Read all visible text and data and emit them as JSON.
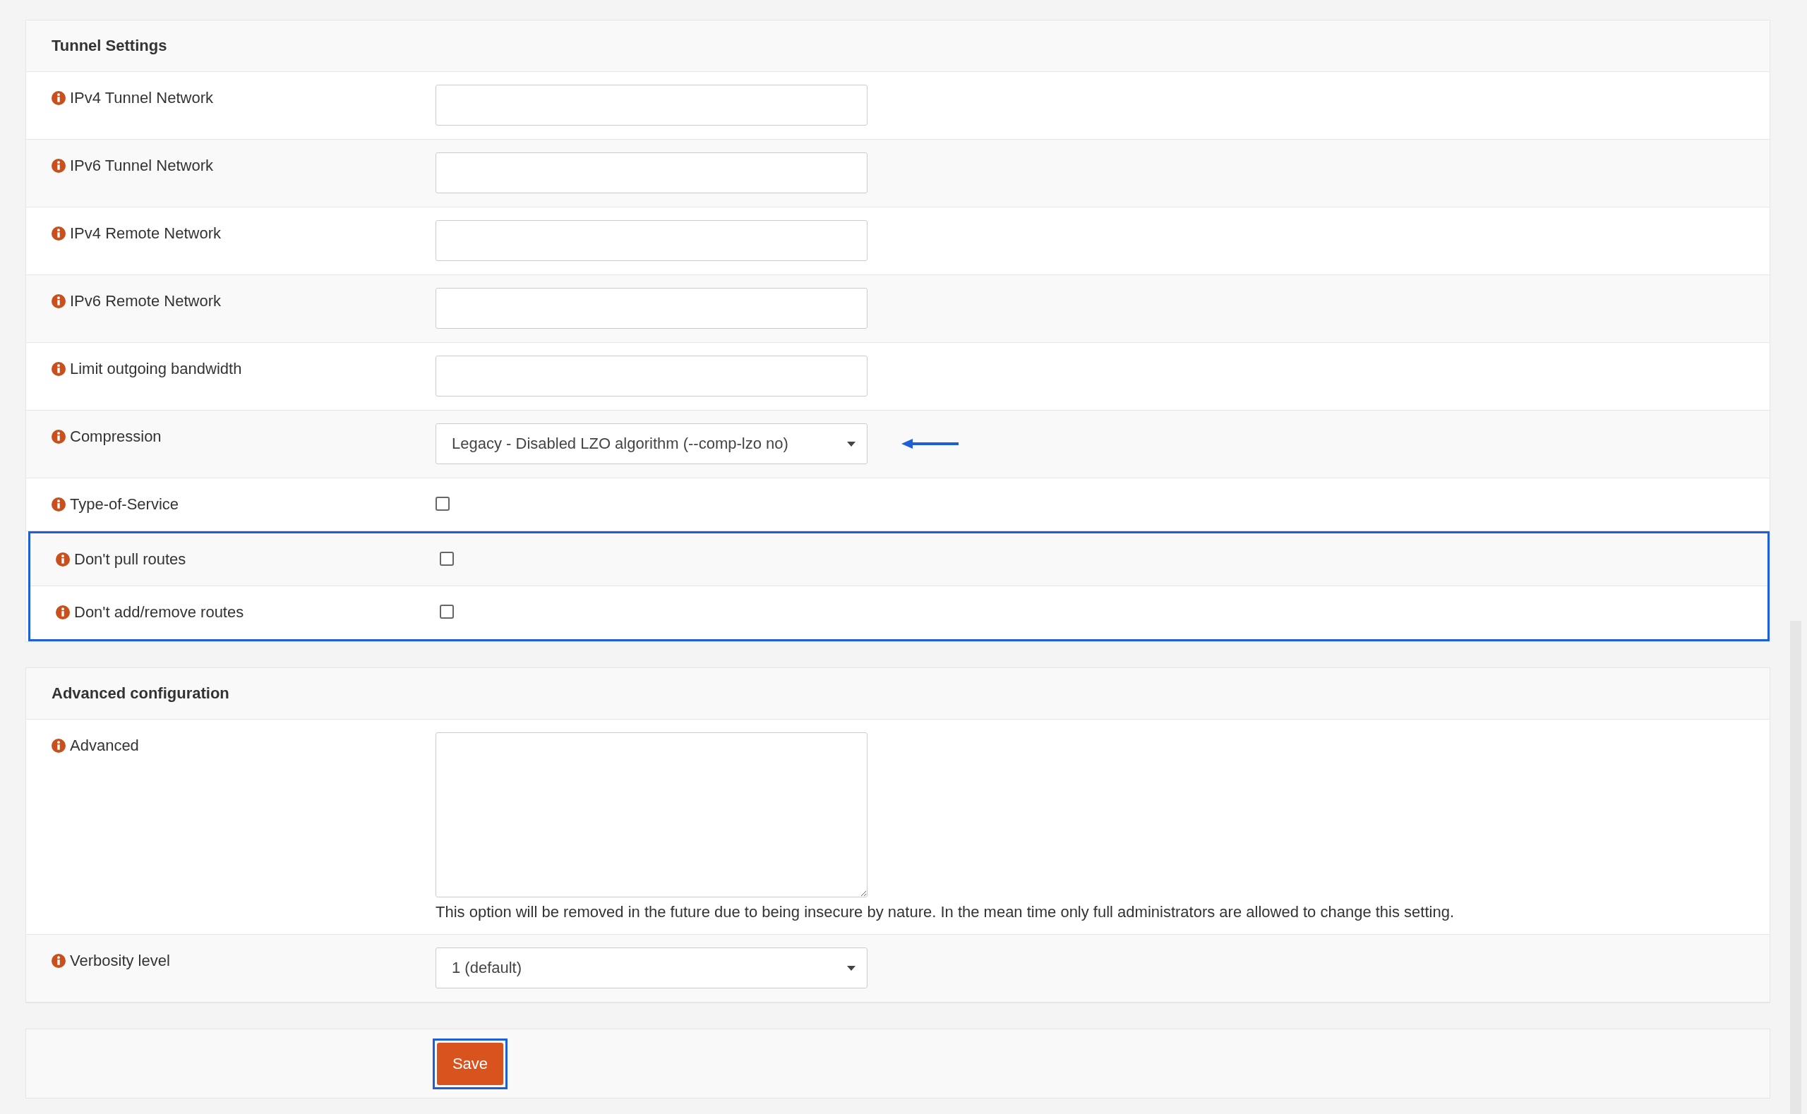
{
  "sections": [
    {
      "title": "Tunnel Settings",
      "groups": [
        {
          "highlighted": false,
          "rows": [
            {
              "kind": "input",
              "label": "IPv4 Tunnel Network"
            },
            {
              "kind": "input",
              "label": "IPv6 Tunnel Network"
            },
            {
              "kind": "input",
              "label": "IPv4 Remote Network"
            },
            {
              "kind": "input",
              "label": "IPv6 Remote Network"
            },
            {
              "kind": "input",
              "label": "Limit outgoing bandwidth"
            },
            {
              "kind": "select",
              "label": "Compression",
              "value": "Legacy - Disabled LZO algorithm (--comp-lzo no)",
              "arrow": true
            },
            {
              "kind": "checkbox",
              "label": "Type-of-Service",
              "checked": false
            }
          ]
        },
        {
          "highlighted": true,
          "rows": [
            {
              "kind": "checkbox",
              "label": "Don't pull routes",
              "checked": false
            },
            {
              "kind": "checkbox",
              "label": "Don't add/remove routes",
              "checked": false
            }
          ]
        }
      ]
    },
    {
      "title": "Advanced configuration",
      "groups": [
        {
          "highlighted": false,
          "rows": [
            {
              "kind": "textarea",
              "label": "Advanced",
              "note": "This option will be removed in the future due to being insecure by nature. In the mean time only full administrators are allowed to change this setting."
            },
            {
              "kind": "select",
              "label": "Verbosity level",
              "value": "1 (default)",
              "arrow": false
            }
          ]
        }
      ]
    }
  ],
  "save": {
    "label": "Save",
    "highlighted": true
  }
}
